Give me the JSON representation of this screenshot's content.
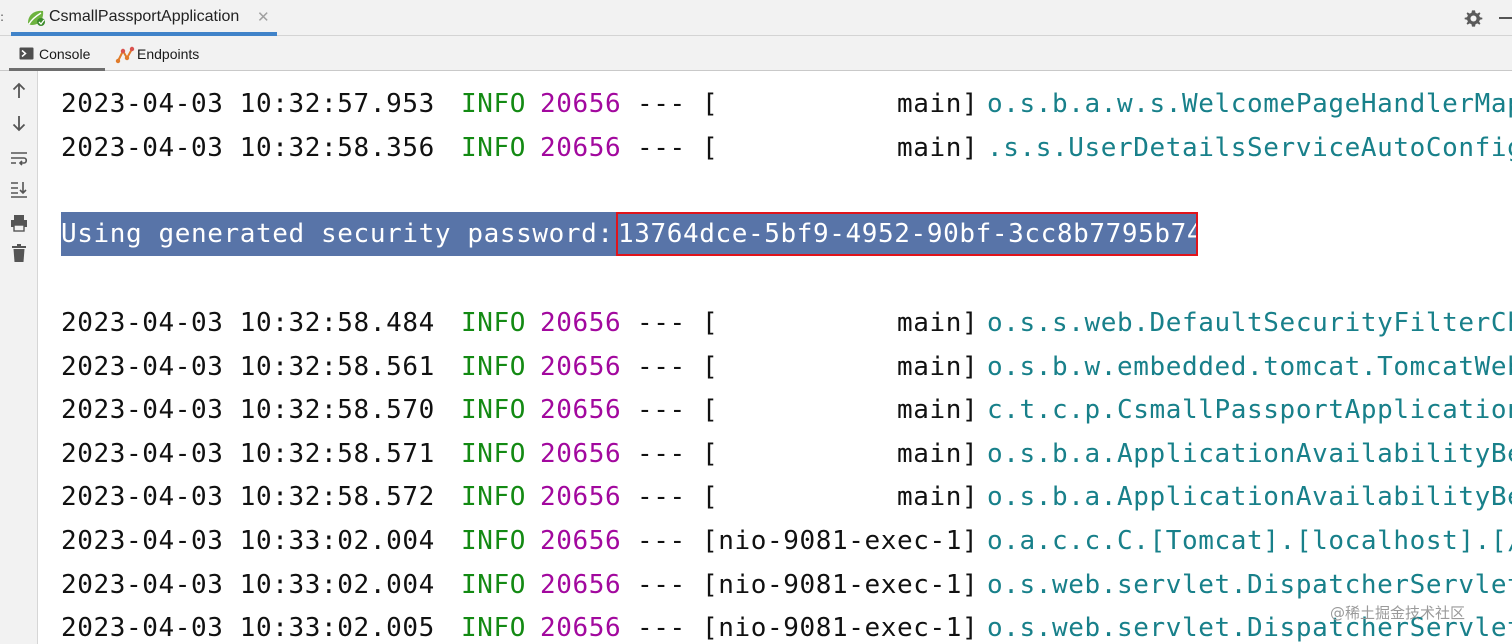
{
  "run_tab": {
    "label": "CsmallPassportApplication",
    "close_glyph": "✕",
    "icon": "spring-boot-icon"
  },
  "toolbar_right": {
    "settings_icon": "gear-icon",
    "minimize_icon": "minimize-icon"
  },
  "sub_tabs": [
    {
      "label": "Console",
      "icon": "console-icon",
      "active": true
    },
    {
      "label": "Endpoints",
      "icon": "endpoints-icon",
      "active": false
    }
  ],
  "side_tools": [
    {
      "icon": "arrow-up-icon"
    },
    {
      "icon": "arrow-down-icon"
    },
    {
      "icon": "soft-wrap-icon"
    },
    {
      "icon": "scroll-to-end-icon"
    },
    {
      "icon": "print-icon"
    },
    {
      "icon": "trash-icon"
    }
  ],
  "console": {
    "password_line": {
      "label": "Using generated security password: ",
      "value": "13764dce-5bf9-4952-90bf-3cc8b7795b74"
    },
    "lines_before": [
      {
        "ts": "2023-04-03 10:32:57.953",
        "level": "INFO",
        "pid": "20656",
        "sep": "---",
        "thread": "[           main]",
        "logger": "o.s.b.a.w.s.WelcomePageHandlerMap"
      },
      {
        "ts": "2023-04-03 10:32:58.356",
        "level": "INFO",
        "pid": "20656",
        "sep": "---",
        "thread": "[           main]",
        "logger": ".s.s.UserDetailsServiceAutoConfig"
      }
    ],
    "lines_after": [
      {
        "ts": "2023-04-03 10:32:58.484",
        "level": "INFO",
        "pid": "20656",
        "sep": "---",
        "thread": "[           main]",
        "logger": "o.s.s.web.DefaultSecurityFilterCh"
      },
      {
        "ts": "2023-04-03 10:32:58.561",
        "level": "INFO",
        "pid": "20656",
        "sep": "---",
        "thread": "[           main]",
        "logger": "o.s.b.w.embedded.tomcat.TomcatWeb"
      },
      {
        "ts": "2023-04-03 10:32:58.570",
        "level": "INFO",
        "pid": "20656",
        "sep": "---",
        "thread": "[           main]",
        "logger": "c.t.c.p.CsmallPassportApplication"
      },
      {
        "ts": "2023-04-03 10:32:58.571",
        "level": "INFO",
        "pid": "20656",
        "sep": "---",
        "thread": "[           main]",
        "logger": "o.s.b.a.ApplicationAvailabilityBe"
      },
      {
        "ts": "2023-04-03 10:32:58.572",
        "level": "INFO",
        "pid": "20656",
        "sep": "---",
        "thread": "[           main]",
        "logger": "o.s.b.a.ApplicationAvailabilityBe"
      },
      {
        "ts": "2023-04-03 10:33:02.004",
        "level": "INFO",
        "pid": "20656",
        "sep": "---",
        "thread": "[nio-9081-exec-1]",
        "logger": "o.a.c.c.C.[Tomcat].[localhost].[/"
      },
      {
        "ts": "2023-04-03 10:33:02.004",
        "level": "INFO",
        "pid": "20656",
        "sep": "---",
        "thread": "[nio-9081-exec-1]",
        "logger": "o.s.web.servlet.DispatcherServlet"
      },
      {
        "ts": "2023-04-03 10:33:02.005",
        "level": "INFO",
        "pid": "20656",
        "sep": "---",
        "thread": "[nio-9081-exec-1]",
        "logger": "o.s.web.servlet.DispatcherServlet"
      }
    ]
  },
  "watermark": "@稀土掘金技术社区",
  "colors": {
    "level": "#138a13",
    "pid": "#a2089e",
    "logger": "#18808a",
    "selection": "#5874a8",
    "highlight_box": "#e0141b",
    "tab_underline": "#4083c9"
  }
}
